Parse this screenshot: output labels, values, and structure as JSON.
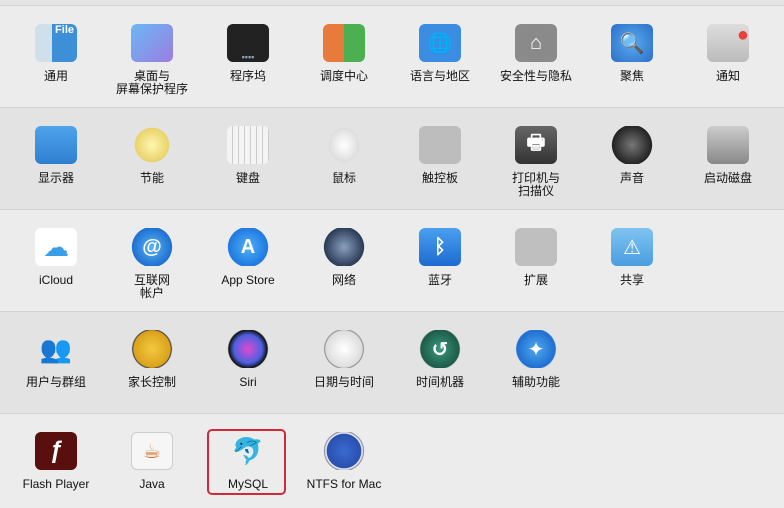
{
  "colors": {
    "highlight": "#d2283a",
    "row_light": "#ececec",
    "row_dark": "#e3e3e3"
  },
  "rows": [
    [
      {
        "label": "通用",
        "icon": "general-icon",
        "bg": "linear-gradient(90deg,#cfe0ea 40%,#3d8fd8 40%)",
        "glyph": "File"
      },
      {
        "label": "桌面与\n屏幕保护程序",
        "icon": "desktop-screensaver-icon",
        "bg": "linear-gradient(135deg,#6ab8f5,#9b7de0)",
        "glyph": ""
      },
      {
        "label": "程序坞",
        "icon": "dock-icon",
        "bg": "#222",
        "glyph": "▪▪▪▪"
      },
      {
        "label": "调度中心",
        "icon": "mission-control-icon",
        "bg": "linear-gradient(90deg,#e87b3c 50%,#4caf50 50%)",
        "glyph": ""
      },
      {
        "label": "语言与地区",
        "icon": "language-region-icon",
        "bg": "#3a8de0",
        "glyph": "🌐"
      },
      {
        "label": "安全性与隐私",
        "icon": "security-privacy-icon",
        "bg": "#8a8a8a",
        "glyph": "⌂"
      },
      {
        "label": "聚焦",
        "icon": "spotlight-icon",
        "bg": "radial-gradient(circle,#5aaaf0,#2b6fc8)",
        "glyph": "🔍"
      },
      {
        "label": "通知",
        "icon": "notifications-icon",
        "bg": "linear-gradient(#ddd,#bbb)",
        "glyph": "●"
      }
    ],
    [
      {
        "label": "显示器",
        "icon": "displays-icon",
        "bg": "linear-gradient(#4ea3ea,#2f7fd0)",
        "glyph": ""
      },
      {
        "label": "节能",
        "icon": "energy-saver-icon",
        "bg": "radial-gradient(circle,#fff6b0,#e8d36a 60%,transparent 62%)",
        "glyph": ""
      },
      {
        "label": "键盘",
        "icon": "keyboard-icon",
        "bg": "repeating-linear-gradient(90deg,#f4f4f4 0 5px,#ccc 5px 6px)",
        "glyph": ""
      },
      {
        "label": "鼠标",
        "icon": "mouse-icon",
        "bg": "radial-gradient(ellipse 40% 50%,#fff,#ddd 90%,transparent 92%)",
        "glyph": ""
      },
      {
        "label": "触控板",
        "icon": "trackpad-icon",
        "bg": "#bdbdbd",
        "glyph": ""
      },
      {
        "label": "打印机与\n扫描仪",
        "icon": "printer-scanner-icon",
        "bg": "linear-gradient(#666,#333)",
        "glyph": "🖶"
      },
      {
        "label": "声音",
        "icon": "sound-icon",
        "bg": "radial-gradient(circle,#777,#222 70%,transparent 72%)",
        "glyph": ""
      },
      {
        "label": "启动磁盘",
        "icon": "startup-disk-icon",
        "bg": "linear-gradient(#ccc,#888)",
        "glyph": ""
      }
    ],
    [
      {
        "label": "iCloud",
        "icon": "icloud-icon",
        "bg": "#fff",
        "glyph": "☁"
      },
      {
        "label": "互联网\n帐户",
        "icon": "internet-accounts-icon",
        "bg": "radial-gradient(circle,#5ab4f5,#1e6fd0 70%,transparent 72%)",
        "glyph": "@"
      },
      {
        "label": "App Store",
        "icon": "app-store-icon",
        "bg": "radial-gradient(circle,#4fb0f5,#1f78e0 70%,transparent 72%)",
        "glyph": "A"
      },
      {
        "label": "网络",
        "icon": "network-icon",
        "bg": "radial-gradient(circle,#8aa0c0,#2a3a55 70%,transparent 72%)",
        "glyph": ""
      },
      {
        "label": "蓝牙",
        "icon": "bluetooth-icon",
        "bg": "linear-gradient(#4aa0f0,#1e6ad0)",
        "glyph": "ᛒ"
      },
      {
        "label": "扩展",
        "icon": "extensions-icon",
        "bg": "#bfbfbf",
        "glyph": ""
      },
      {
        "label": "共享",
        "icon": "sharing-icon",
        "bg": "linear-gradient(#7fc4f0,#4a9ee0)",
        "glyph": "⚠"
      }
    ],
    [
      {
        "label": "用户与群组",
        "icon": "users-groups-icon",
        "bg": "transparent",
        "glyph": "👥"
      },
      {
        "label": "家长控制",
        "icon": "parental-controls-icon",
        "bg": "radial-gradient(circle,#f5c842,#d9a11a 65%,#333 68%,transparent 72%)",
        "glyph": ""
      },
      {
        "label": "Siri",
        "icon": "siri-icon",
        "bg": "radial-gradient(circle,#e04ad0,#4a60e0 50%,#111 68%,transparent 72%)",
        "glyph": ""
      },
      {
        "label": "日期与时间",
        "icon": "date-time-icon",
        "bg": "radial-gradient(circle,#fff,#ddd 65%,#888 68%,transparent 72%)",
        "glyph": ""
      },
      {
        "label": "时间机器",
        "icon": "time-machine-icon",
        "bg": "radial-gradient(circle,#3a9a7a,#1d5a4a 68%,transparent 72%)",
        "glyph": "↺"
      },
      {
        "label": "辅助功能",
        "icon": "accessibility-icon",
        "bg": "radial-gradient(circle,#4fa8f0,#1f6ed0 68%,transparent 72%)",
        "glyph": "✦"
      }
    ],
    [
      {
        "label": "Flash Player",
        "icon": "flash-player-icon",
        "bg": "#5a0f0f",
        "glyph": "ƒ"
      },
      {
        "label": "Java",
        "icon": "java-icon",
        "bg": "#f6f6f6",
        "glyph": "☕"
      },
      {
        "label": "MySQL",
        "icon": "mysql-dolphin-icon",
        "bg": "transparent",
        "glyph": "🐬"
      },
      {
        "label": "NTFS for Mac",
        "icon": "ntfs-for-mac-icon",
        "bg": "radial-gradient(circle,#3a6ad0,#2a50b0 60%,#fff 63%,#889 70%,transparent 72%)",
        "glyph": ""
      }
    ]
  ]
}
